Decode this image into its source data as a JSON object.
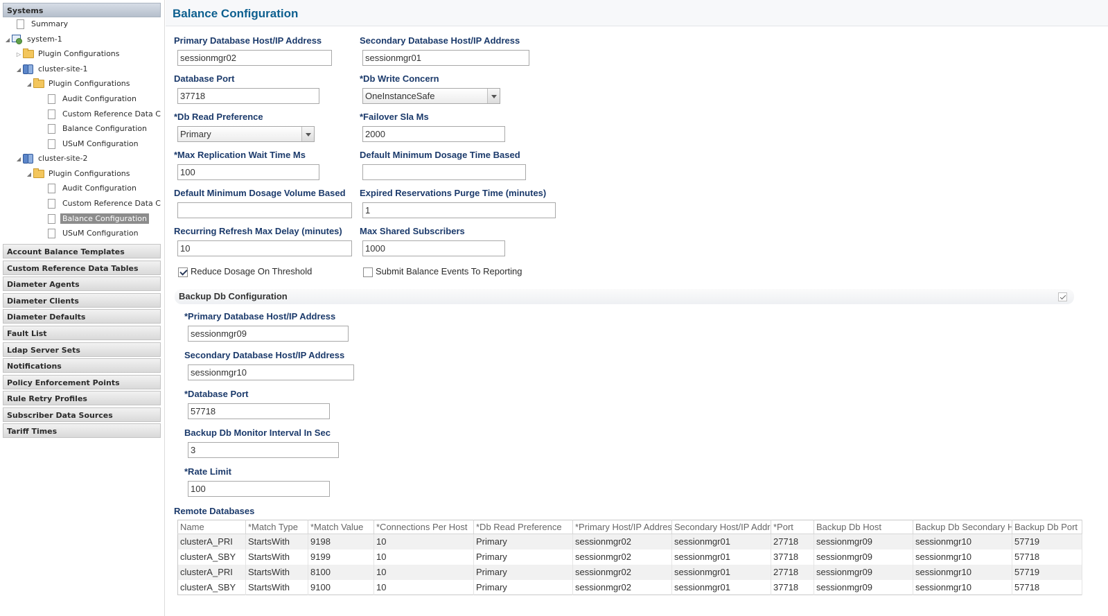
{
  "sidebar": {
    "systems_header": "Systems",
    "tree": {
      "summary": "Summary",
      "system1": "system-1",
      "plugin_configurations": "Plugin Configurations",
      "cluster_site_1": "cluster-site-1",
      "cluster_site_2": "cluster-site-2",
      "c1_plugin": "Plugin Configurations",
      "c1_audit": "Audit Configuration",
      "c1_custom_ref": "Custom Reference Data C",
      "c1_balance": "Balance Configuration",
      "c1_usum": "USuM Configuration",
      "c2_plugin": "Plugin Configurations",
      "c2_audit": "Audit Configuration",
      "c2_custom_ref": "Custom Reference Data C",
      "c2_balance": "Balance Configuration",
      "c2_usum": "USuM Configuration"
    },
    "sections": [
      "Account Balance Templates",
      "Custom Reference Data Tables",
      "Diameter Agents",
      "Diameter Clients",
      "Diameter Defaults",
      "Fault List",
      "Ldap Server Sets",
      "Notifications",
      "Policy Enforcement Points",
      "Rule Retry Profiles",
      "Subscriber Data Sources",
      "Tariff Times"
    ]
  },
  "main": {
    "title": "Balance Configuration",
    "fields": {
      "primary_db_host_label": "Primary Database Host/IP Address",
      "primary_db_host_value": "sessionmgr02",
      "secondary_db_host_label": "Secondary Database Host/IP Address",
      "secondary_db_host_value": "sessionmgr01",
      "db_port_label": "Database Port",
      "db_port_value": "37718",
      "db_write_concern_label": "*Db Write Concern",
      "db_write_concern_value": "OneInstanceSafe",
      "db_read_pref_label": "*Db Read Preference",
      "db_read_pref_value": "Primary",
      "failover_sla_label": "*Failover Sla Ms",
      "failover_sla_value": "2000",
      "max_repl_wait_label": "*Max Replication Wait Time Ms",
      "max_repl_wait_value": "100",
      "default_min_dosage_time_label": "Default Minimum Dosage Time Based",
      "default_min_dosage_time_value": "",
      "default_min_dosage_volume_label": "Default Minimum Dosage Volume Based",
      "default_min_dosage_volume_value": "",
      "expired_res_purge_label": "Expired Reservations Purge Time (minutes)",
      "expired_res_purge_value": "1",
      "recurring_refresh_label": "Recurring Refresh Max Delay (minutes)",
      "recurring_refresh_value": "10",
      "max_shared_subs_label": "Max Shared Subscribers",
      "max_shared_subs_value": "1000",
      "reduce_dosage_label": "Reduce Dosage On Threshold",
      "reduce_dosage_checked": true,
      "submit_events_label": "Submit Balance Events To Reporting",
      "submit_events_checked": false
    },
    "backup": {
      "title": "Backup Db Configuration",
      "primary_host_label": "*Primary Database Host/IP Address",
      "primary_host_value": "sessionmgr09",
      "secondary_host_label": "Secondary Database Host/IP Address",
      "secondary_host_value": "sessionmgr10",
      "port_label": "*Database Port",
      "port_value": "57718",
      "monitor_interval_label": "Backup Db Monitor Interval In Sec",
      "monitor_interval_value": "3",
      "rate_limit_label": "*Rate Limit",
      "rate_limit_value": "100"
    },
    "remote": {
      "title": "Remote Databases",
      "columns": [
        "Name",
        "*Match Type",
        "*Match Value",
        "*Connections Per Host",
        "*Db Read Preference",
        "*Primary Host/IP Address",
        "Secondary Host/IP Address",
        "*Port",
        "Backup Db Host",
        "Backup Db Secondary Host",
        "Backup Db Port"
      ],
      "rows": [
        [
          "clusterA_PRI",
          "StartsWith",
          "9198",
          "10",
          "Primary",
          "sessionmgr02",
          "sessionmgr01",
          "27718",
          "sessionmgr09",
          "sessionmgr10",
          "57719"
        ],
        [
          "clusterA_SBY",
          "StartsWith",
          "9199",
          "10",
          "Primary",
          "sessionmgr02",
          "sessionmgr01",
          "37718",
          "sessionmgr09",
          "sessionmgr10",
          "57718"
        ],
        [
          "clusterA_PRI",
          "StartsWith",
          "8100",
          "10",
          "Primary",
          "sessionmgr02",
          "sessionmgr01",
          "27718",
          "sessionmgr09",
          "sessionmgr10",
          "57719"
        ],
        [
          "clusterA_SBY",
          "StartsWith",
          "9100",
          "10",
          "Primary",
          "sessionmgr02",
          "sessionmgr01",
          "37718",
          "sessionmgr09",
          "sessionmgr10",
          "57718"
        ]
      ]
    }
  }
}
